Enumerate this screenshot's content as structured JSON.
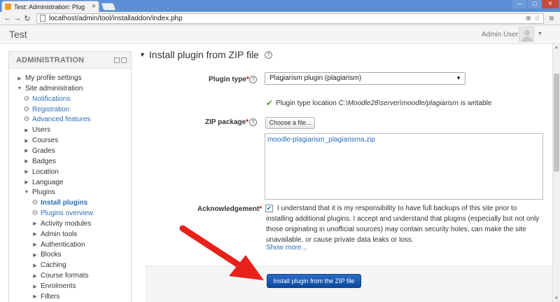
{
  "browser": {
    "tab_title": "Test: Administration: Plug",
    "tab_close": "×",
    "url": "localhost/admin/tool/installaddon/index.php",
    "window_controls": {
      "minimize": "–",
      "maximize": "□",
      "close": "×"
    }
  },
  "header": {
    "site_name": "Test",
    "user_name": "Admin User"
  },
  "admin_block": {
    "title": "ADMINISTRATION",
    "items": [
      {
        "label": "My profile settings",
        "level": 0,
        "icon": "arrow-right",
        "style": "plain"
      },
      {
        "label": "Site administration",
        "level": 0,
        "icon": "arrow-down",
        "style": "plain"
      },
      {
        "label": "Notifications",
        "level": 1,
        "icon": "gear",
        "style": "link"
      },
      {
        "label": "Registration",
        "level": 1,
        "icon": "gear",
        "style": "link"
      },
      {
        "label": "Advanced features",
        "level": 1,
        "icon": "gear",
        "style": "link"
      },
      {
        "label": "Users",
        "level": 1,
        "icon": "arrow-right",
        "style": "plain"
      },
      {
        "label": "Courses",
        "level": 1,
        "icon": "arrow-right",
        "style": "plain"
      },
      {
        "label": "Grades",
        "level": 1,
        "icon": "arrow-right",
        "style": "plain"
      },
      {
        "label": "Badges",
        "level": 1,
        "icon": "arrow-right",
        "style": "plain"
      },
      {
        "label": "Location",
        "level": 1,
        "icon": "arrow-right",
        "style": "plain"
      },
      {
        "label": "Language",
        "level": 1,
        "icon": "arrow-right",
        "style": "plain"
      },
      {
        "label": "Plugins",
        "level": 1,
        "icon": "arrow-down",
        "style": "plain"
      },
      {
        "label": "Install plugins",
        "level": 2,
        "icon": "gear",
        "style": "bold"
      },
      {
        "label": "Plugins overview",
        "level": 2,
        "icon": "gear",
        "style": "link"
      },
      {
        "label": "Activity modules",
        "level": 2,
        "icon": "arrow-right",
        "style": "plain"
      },
      {
        "label": "Admin tools",
        "level": 2,
        "icon": "arrow-right",
        "style": "plain"
      },
      {
        "label": "Authentication",
        "level": 2,
        "icon": "arrow-right",
        "style": "plain"
      },
      {
        "label": "Blocks",
        "level": 2,
        "icon": "arrow-right",
        "style": "plain"
      },
      {
        "label": "Caching",
        "level": 2,
        "icon": "arrow-right",
        "style": "plain"
      },
      {
        "label": "Course formats",
        "level": 2,
        "icon": "arrow-right",
        "style": "plain"
      },
      {
        "label": "Enrolments",
        "level": 2,
        "icon": "arrow-right",
        "style": "plain"
      },
      {
        "label": "Filters",
        "level": 2,
        "icon": "arrow-right",
        "style": "plain"
      }
    ]
  },
  "main": {
    "heading": "Install plugin from ZIP file",
    "help_glyph": "?",
    "plugin_type": {
      "label": "Plugin type",
      "required": "*",
      "selected": "Plagiarism plugin (plagiarism)"
    },
    "type_location": {
      "prefix": "Plugin type location",
      "path": "C:\\Moodle28\\server\\moodle/plagiarism",
      "suffix": "is writable"
    },
    "zip_package": {
      "label": "ZIP package",
      "required": "*",
      "button": "Choose a file...",
      "file_name": "moodle-plagiarism_plagiarisma.zip"
    },
    "acknowledgement": {
      "label": "Acknowledgement",
      "required": "*",
      "checked": true,
      "text": "I understand that it is my responsibility to have full backups of this site prior to installing additional plugins. I accept and understand that plugins (especially but not only those originating in unofficial sources) may contain security holes, can make the site unavailable, or cause private data leaks or loss.",
      "show_more": "Show more..."
    },
    "submit_label": "Install plugin from the ZIP file"
  },
  "colors": {
    "link": "#2a6ebb",
    "required": "#cc0000",
    "primary_button": "#0d4a9e",
    "annotation_arrow": "#e8221b",
    "check": "#5aa428"
  }
}
